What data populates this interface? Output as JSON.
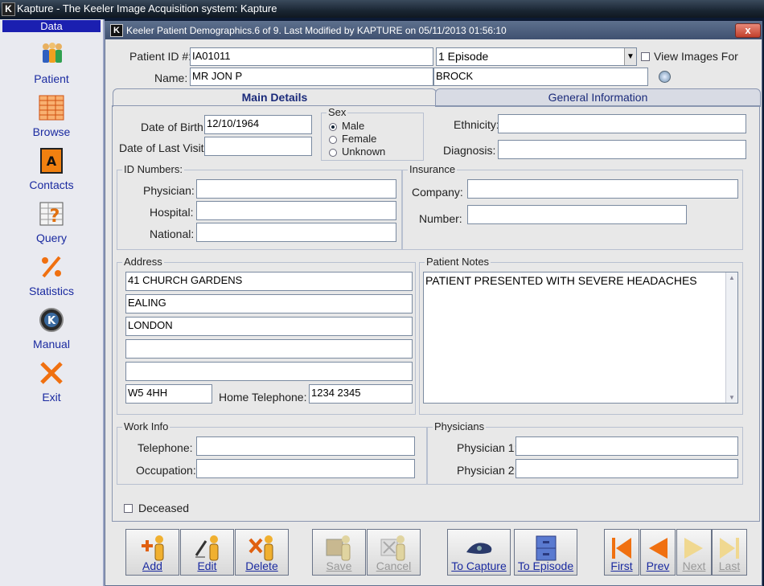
{
  "app": {
    "title": "Kapture - The Keeler Image Acquisition system: Kapture"
  },
  "sidebar": {
    "header": "Data",
    "items": [
      {
        "label": "Patient",
        "icon": "patient-icon"
      },
      {
        "label": "Browse",
        "icon": "browse-icon"
      },
      {
        "label": "Contacts",
        "icon": "contacts-icon"
      },
      {
        "label": "Query",
        "icon": "query-icon"
      },
      {
        "label": "Statistics",
        "icon": "statistics-icon"
      },
      {
        "label": "Manual",
        "icon": "manual-icon"
      },
      {
        "label": "Exit",
        "icon": "exit-icon"
      }
    ]
  },
  "window": {
    "title": "Keeler Patient Demographics.6 of 9. Last Modified by KAPTURE on 05/11/2013 01:56:10",
    "close": "x"
  },
  "header": {
    "patient_id_label": "Patient ID #:",
    "patient_id": "IA01011",
    "episode": "1 Episode",
    "view_images_label": "View Images For",
    "name_label": "Name:",
    "first_name": "MR JON P",
    "surname": "BROCK"
  },
  "tabs": [
    {
      "label": "Main Details",
      "active": true
    },
    {
      "label": "General Information",
      "active": false
    }
  ],
  "main": {
    "dob_label": "Date of Birth:",
    "dob": "12/10/1964",
    "last_visit_label": "Date of Last Visit:",
    "last_visit": "",
    "sex": {
      "title": "Sex",
      "options": [
        "Male",
        "Female",
        "Unknown"
      ],
      "selected": "Male"
    },
    "ethnicity_label": "Ethnicity:",
    "ethnicity": "",
    "diagnosis_label": "Diagnosis:",
    "diagnosis": "",
    "id_numbers": {
      "title": "ID Numbers:",
      "physician_label": "Physician:",
      "hospital_label": "Hospital:",
      "national_label": "National:",
      "physician": "",
      "hospital": "",
      "national": ""
    },
    "insurance": {
      "title": "Insurance",
      "company_label": "Company:",
      "number_label": "Number:",
      "company": "",
      "number": ""
    },
    "address": {
      "title": "Address",
      "lines": [
        "41 CHURCH GARDENS",
        "EALING",
        "LONDON",
        "",
        ""
      ],
      "postcode": "W5 4HH",
      "home_tel_label": "Home Telephone:",
      "home_tel": "1234 2345"
    },
    "notes": {
      "title": "Patient Notes",
      "text": "PATIENT PRESENTED WITH SEVERE HEADACHES"
    },
    "work": {
      "title": "Work Info",
      "telephone_label": "Telephone:",
      "occupation_label": "Occupation:",
      "telephone": "",
      "occupation": ""
    },
    "physicians": {
      "title": "Physicians",
      "p1_label": "Physician 1:",
      "p2_label": "Physician 2:",
      "p1": "",
      "p2": ""
    },
    "deceased_label": "Deceased"
  },
  "toolbar": {
    "add": "Add",
    "edit": "Edit",
    "delete": "Delete",
    "save": "Save",
    "cancel": "Cancel",
    "to_capture": "To Capture",
    "to_episode": "To Episode",
    "first": "First",
    "prev": "Prev",
    "next": "Next",
    "last": "Last"
  },
  "colors": {
    "accent": "#1b1fb0",
    "nav_orange": "#f07010",
    "window_bg": "#e8e8e8"
  }
}
